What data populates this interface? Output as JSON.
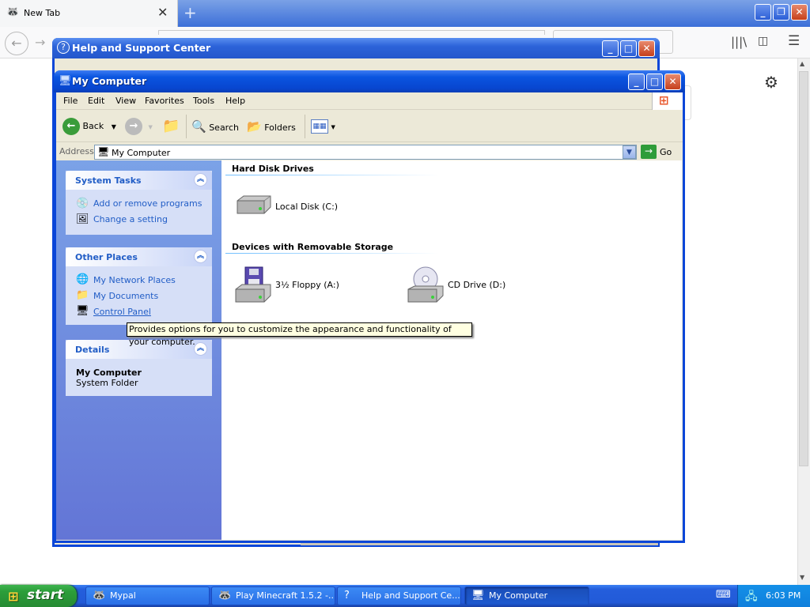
{
  "browser": {
    "tab_title": "New Tab",
    "tab_close": "✕",
    "new_tab": "+",
    "back": "←",
    "forward": "→",
    "library": "|||\\",
    "sidebar": "◫",
    "menu": "☰",
    "settings": "⚙"
  },
  "help_window": {
    "title": "Help and Support Center"
  },
  "my_computer": {
    "title": "My Computer",
    "menu": [
      "File",
      "Edit",
      "View",
      "Favorites",
      "Tools",
      "Help"
    ],
    "toolbar": {
      "back": "Back",
      "search": "Search",
      "folders": "Folders"
    },
    "address": {
      "label": "Address",
      "value": "My Computer",
      "go": "Go"
    },
    "system_tasks": {
      "title": "System Tasks",
      "links": [
        "Add or remove programs",
        "Change a setting"
      ]
    },
    "other_places": {
      "title": "Other Places",
      "links": [
        "My Network Places",
        "My Documents",
        "Control Panel"
      ]
    },
    "details": {
      "title": "Details",
      "name": "My Computer",
      "type": "System Folder"
    },
    "groups": {
      "hard_disks": "Hard Disk Drives",
      "removable": "Devices with Removable Storage"
    },
    "drives": {
      "local_disk": "Local Disk (C:)",
      "floppy": "3½ Floppy (A:)",
      "cd": "CD Drive (D:)"
    },
    "tooltip": "Provides options for you to customize the appearance and functionality of your computer."
  },
  "taskbar": {
    "start": "start",
    "tasks": [
      "Mypal",
      "Play Minecraft 1.5.2 -...",
      "Help and Support Ce...",
      "My Computer"
    ],
    "time": "6:03 PM"
  }
}
